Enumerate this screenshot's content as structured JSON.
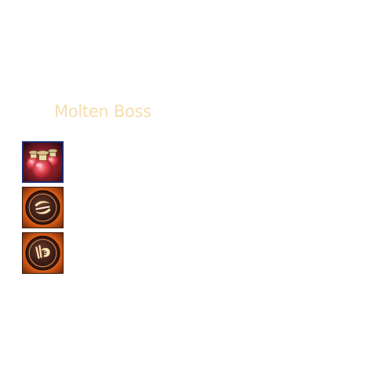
{
  "boss": {
    "title": "Molten Boss"
  },
  "abilities": [
    {
      "icon": "potion-flasks-icon",
      "frame_color": "#1c2a6e"
    },
    {
      "icon": "fire-swirl-rune-icon",
      "frame_color": "#3a1f12"
    },
    {
      "icon": "fire-claw-rune-icon",
      "frame_color": "#3a1f12"
    }
  ],
  "colors": {
    "title": "#f5deaf",
    "ember": "#ff8a1e",
    "potion_red": "#d8303a"
  }
}
